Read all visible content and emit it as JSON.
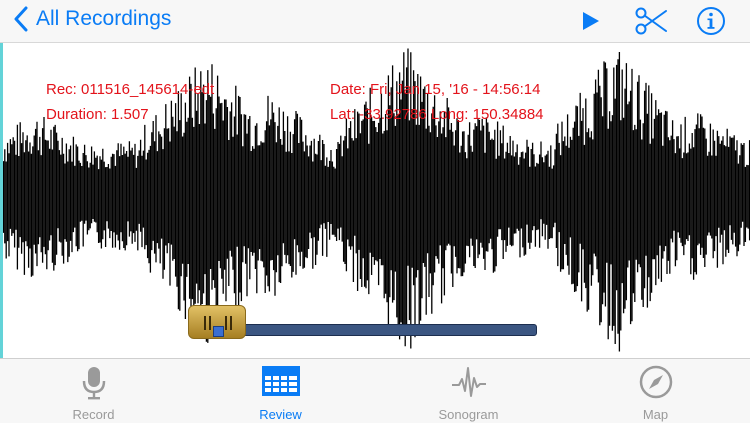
{
  "nav": {
    "back_label": "All Recordings",
    "actions": [
      "play-icon",
      "scissors-icon",
      "info-icon"
    ]
  },
  "recording": {
    "name_line": "Rec: 011516_145614-edt",
    "duration_line": "Duration: 1.507",
    "date_line": "Date: Fri, Jan 15, '16 - 14:56:14",
    "location_line": "Lat: -33.92786 Long: 150.34884"
  },
  "playback": {
    "position_fraction": 0.08
  },
  "tabs": [
    {
      "label": "Record",
      "icon": "microphone-icon",
      "active": false
    },
    {
      "label": "Review",
      "icon": "review-grid-icon",
      "active": true
    },
    {
      "label": "Sonogram",
      "icon": "sonogram-icon",
      "active": false
    },
    {
      "label": "Map",
      "icon": "compass-icon",
      "active": false
    }
  ],
  "colors": {
    "accent": "#0a7cf5",
    "info_text": "#e3131b",
    "waveform": "#000000",
    "inactive_tab": "#9a9a9a"
  }
}
